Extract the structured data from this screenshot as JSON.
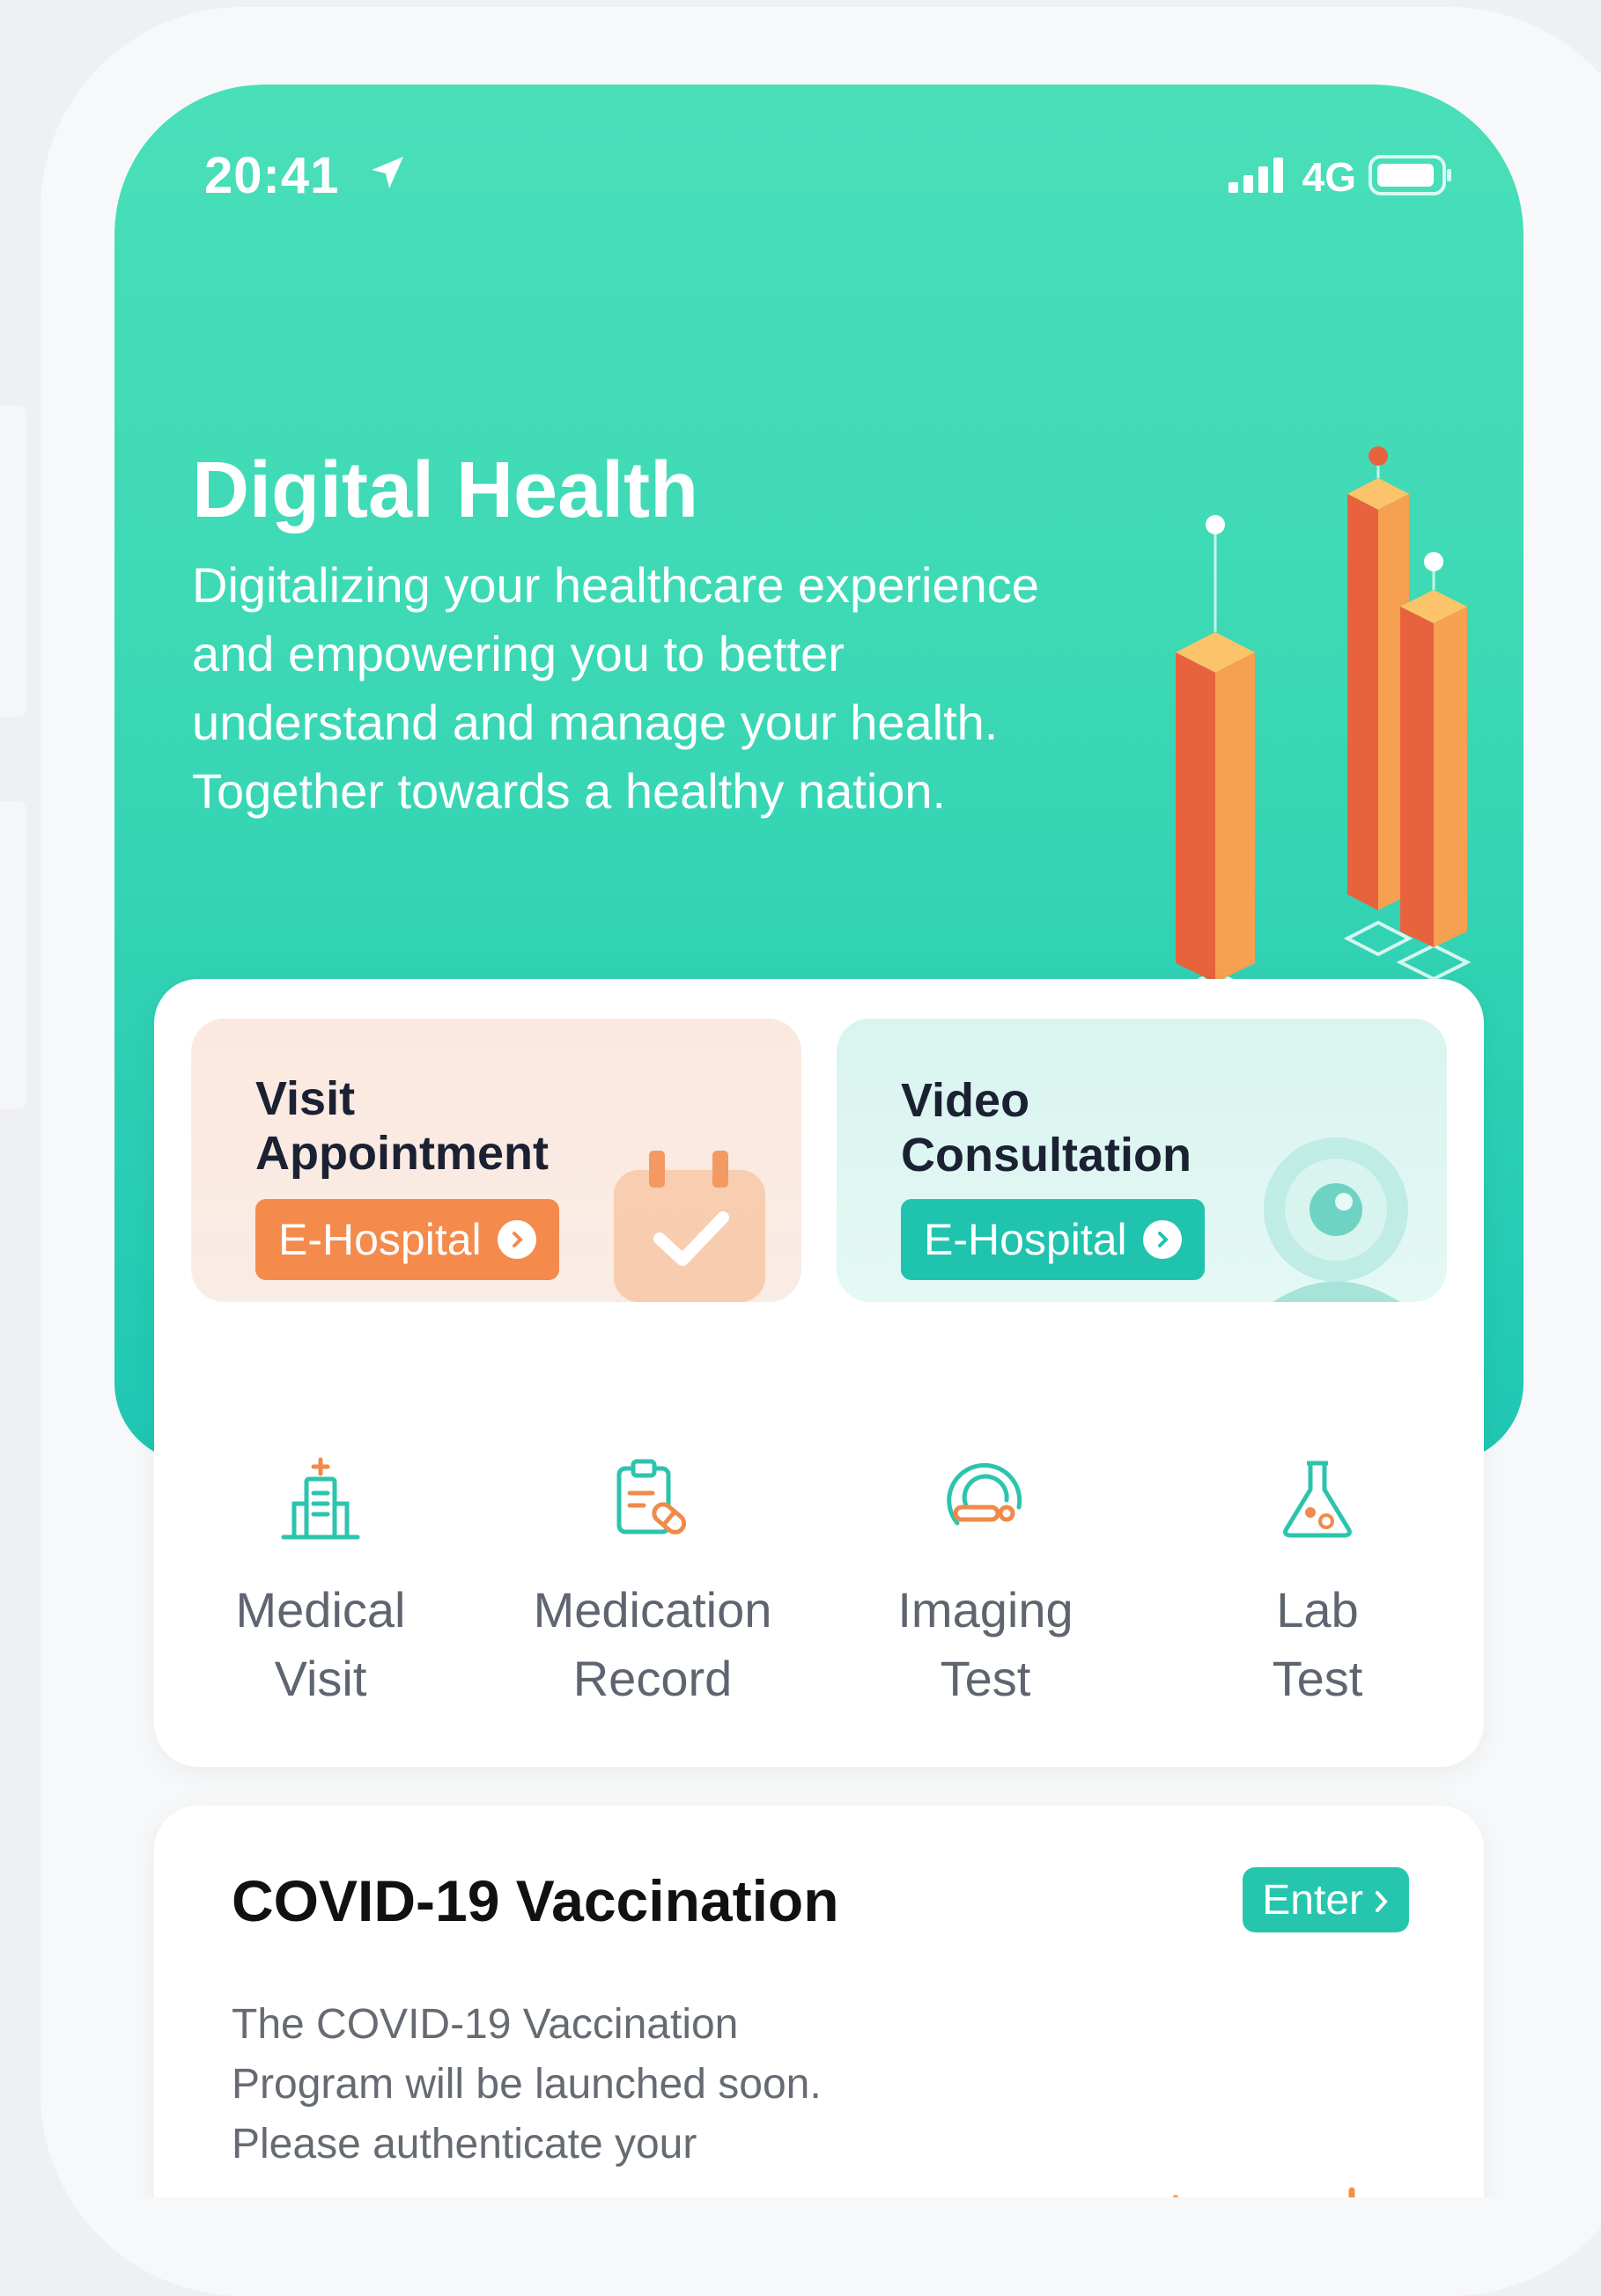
{
  "status_bar": {
    "time": "20:41",
    "network": "4G"
  },
  "hero": {
    "title": "Digital Health",
    "description": "Digitalizing your healthcare experience and empowering you to better understand and manage your health. Together towards a healthy nation."
  },
  "featured": [
    {
      "title_line1": "Visit",
      "title_line2": "Appointment",
      "button": "E-Hospital",
      "accent": "#f48a4b"
    },
    {
      "title_line1": "Video",
      "title_line2": "Consultation",
      "button": "E-Hospital",
      "accent": "#20c3ad"
    }
  ],
  "quick_links": [
    {
      "line1": "Medical",
      "line2": "Visit",
      "icon": "hospital-icon"
    },
    {
      "line1": "Medication",
      "line2": "Record",
      "icon": "medication-record-icon"
    },
    {
      "line1": "Imaging",
      "line2": "Test",
      "icon": "imaging-scanner-icon"
    },
    {
      "line1": "Lab",
      "line2": "Test",
      "icon": "lab-flask-icon"
    }
  ],
  "covid": {
    "title": "COVID-19 Vaccination",
    "enter_label": "Enter",
    "desc_line1": "The COVID-19 Vaccination",
    "desc_line2": "Program will be launched soon.",
    "desc_line3": "Please authenticate your"
  },
  "colors": {
    "brand_teal": "#3dd9b5",
    "accent_orange": "#f48a4b",
    "accent_teal": "#20c3ad"
  }
}
